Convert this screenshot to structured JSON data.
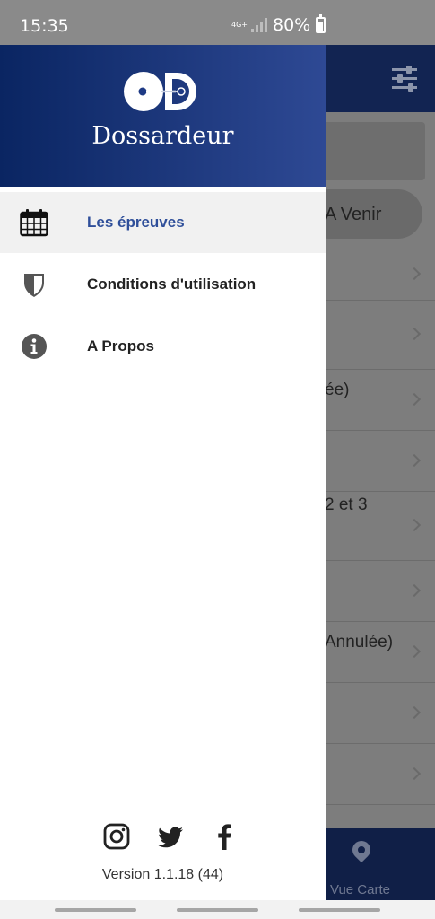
{
  "status_bar": {
    "time": "15:35",
    "network": "4G+",
    "battery": "80%"
  },
  "drawer": {
    "brand": "Dossardeur",
    "menu": [
      {
        "label": "Les épreuves",
        "icon": "calendar-icon",
        "active": true
      },
      {
        "label": "Conditions d'utilisation",
        "icon": "shield-icon",
        "active": false
      },
      {
        "label": "A Propos",
        "icon": "info-icon",
        "active": false
      }
    ],
    "socials": [
      "instagram-icon",
      "twitter-icon",
      "facebook-icon"
    ],
    "version": "Version 1.1.18 (44)",
    "accent_color": "#2f4f9a"
  },
  "background": {
    "tab_label": "A Venir",
    "rows": [
      "",
      "",
      "ée)",
      "",
      "2 et 3",
      "",
      "Annulée)",
      "",
      ""
    ],
    "bottom_label": "Vue Carte"
  }
}
